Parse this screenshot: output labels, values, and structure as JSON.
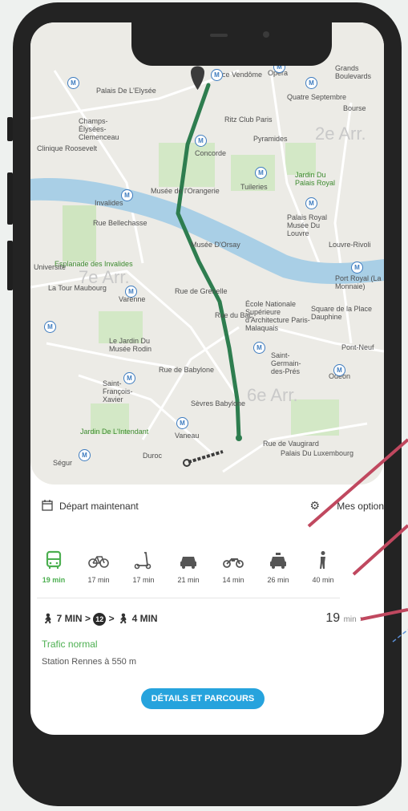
{
  "colors": {
    "accent_green": "#4caf50",
    "route": "#2e7d4f",
    "button_blue": "#26a3dd",
    "annotation": "#c0485f"
  },
  "map": {
    "district_labels": [
      "2e Arr.",
      "7e Arr.",
      "6e Arr."
    ],
    "place_labels": [
      "Palais De L'Elysée",
      "Champs-Élysées-Clemenceau",
      "Clinique Roosevelt",
      "Invalides",
      "Esplanade des Invalides",
      "La Tour Maubourg",
      "Varenne",
      "Le Jardin Du Musée Rodin",
      "Saint-François-Xavier",
      "Jardin De L'Intendant",
      "Ségur",
      "Duroc",
      "Vaneau",
      "Concorde",
      "Musée de l'Orangerie",
      "Tuileries",
      "Pyramides",
      "Musée D'Orsay",
      "Jardin Du Palais Royal",
      "Palais Royal Musée Du Louvre",
      "Louvre-Rivoli",
      "Rue de Grenelle",
      "Rue du Bac",
      "Rue de Babylone",
      "Sèvres Babylone",
      "Saint-Germain-des-Prés",
      "Odéon",
      "École Nationale Supérieure d'Architecture Paris-Malaquais",
      "Rue de Vaugirard",
      "Palais Du Luxembourg",
      "Quatre Septembre",
      "Opéra",
      "Ritz Club Paris",
      "Bourse",
      "Grands Boulevards",
      "Port Royal (La Monnaie)",
      "Square de la Place Dauphine",
      "Université",
      "Pont-Neuf",
      "Rue Bellechasse",
      "Place Vendôme"
    ]
  },
  "departure": {
    "label": "Départ maintenant",
    "options_label": "Mes options"
  },
  "modes": [
    {
      "name": "bus",
      "time": "19 min",
      "active": true
    },
    {
      "name": "bike",
      "time": "17 min",
      "active": false
    },
    {
      "name": "scooter",
      "time": "17 min",
      "active": false
    },
    {
      "name": "car",
      "time": "21 min",
      "active": false
    },
    {
      "name": "motorbike",
      "time": "14 min",
      "active": false
    },
    {
      "name": "taxi",
      "time": "26 min",
      "active": false
    },
    {
      "name": "walk",
      "time": "40 min",
      "active": false
    }
  ],
  "itinerary": {
    "walk1": "7 MIN",
    "sep": ">",
    "line": "12",
    "walk2": "4 MIN",
    "total_value": "19",
    "total_unit": "min",
    "chevron": ">"
  },
  "status": {
    "trafic": "Trafic normal",
    "station": "Station Rennes à 550 m"
  },
  "details_button": "DÉTAILS ET PARCOURS"
}
